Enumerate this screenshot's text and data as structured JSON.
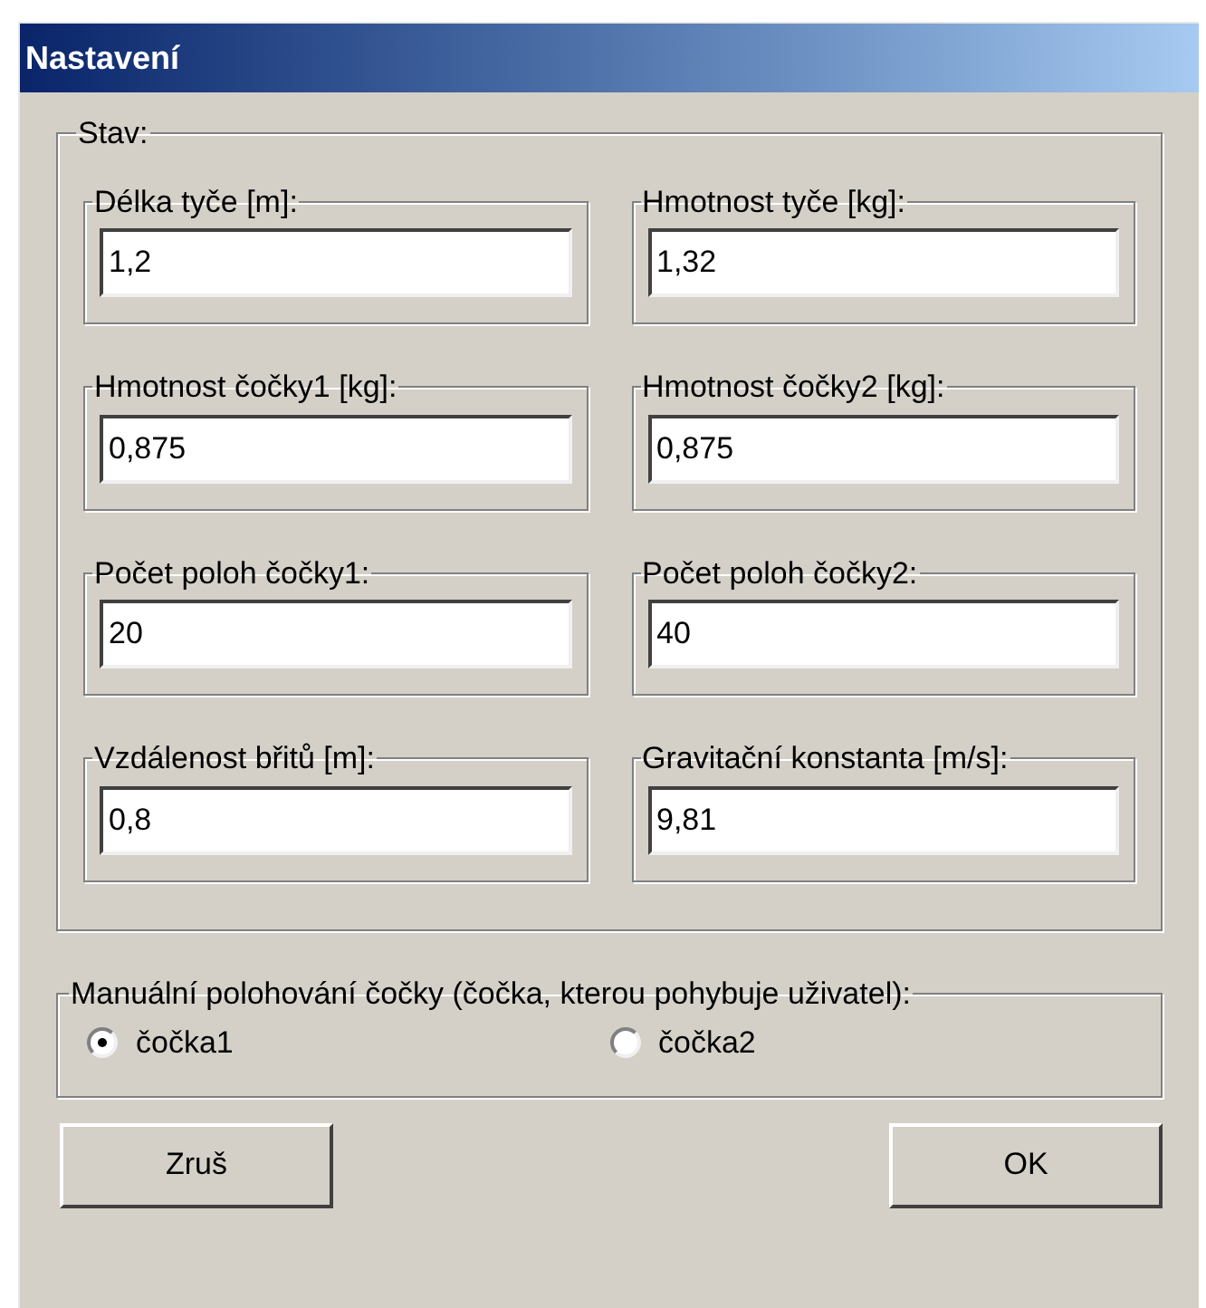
{
  "window": {
    "title": "Nastavení"
  },
  "state_group": {
    "label": "Stav:",
    "fields": [
      {
        "label": "Délka tyče [m]:",
        "value": "1,2"
      },
      {
        "label": "Hmotnost tyče [kg]:",
        "value": "1,32"
      },
      {
        "label": "Hmotnost čočky1 [kg]:",
        "value": "0,875"
      },
      {
        "label": "Hmotnost čočky2 [kg]:",
        "value": "0,875"
      },
      {
        "label": "Počet poloh čočky1:",
        "value": "20"
      },
      {
        "label": "Počet poloh čočky2:",
        "value": "40"
      },
      {
        "label": "Vzdálenost břitů [m]:",
        "value": "0,8"
      },
      {
        "label": "Gravitační konstanta [m/s]:",
        "value": "9,81"
      }
    ]
  },
  "manual_group": {
    "label": "Manuální polohování čočky (čočka, kterou pohybuje uživatel):",
    "options": [
      {
        "label": "čočka1",
        "selected": true
      },
      {
        "label": "čočka2",
        "selected": false
      }
    ]
  },
  "buttons": [
    "Zruš",
    "OK"
  ]
}
